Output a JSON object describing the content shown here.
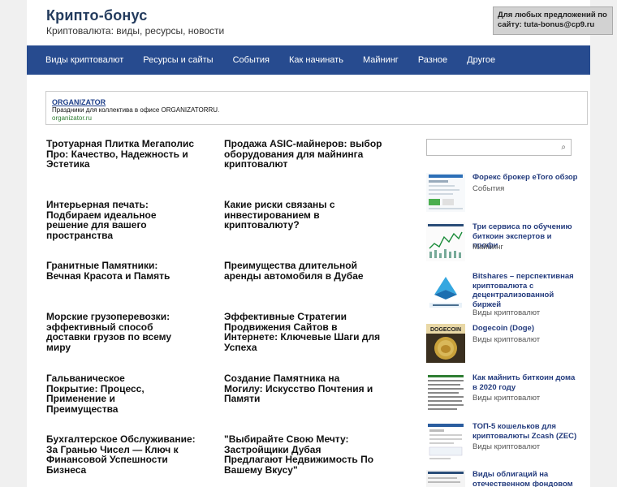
{
  "header": {
    "site_title": "Крипто-бонус",
    "site_description": "Криптовалюта: виды, ресурсы, новости",
    "ad_text": "Для любых предложений по сайту: tuta-bonus@cp9.ru"
  },
  "nav": {
    "items": [
      {
        "label": "Виды криптовалют"
      },
      {
        "label": "Ресурсы и сайты"
      },
      {
        "label": "События"
      },
      {
        "label": "Как начинать"
      },
      {
        "label": "Майнинг"
      },
      {
        "label": "Разное"
      },
      {
        "label": "Другое"
      }
    ]
  },
  "banner": {
    "brand": "ORGANIZATOR",
    "text": "Праздники для коллектива в офисе ORGANIZATORRU.",
    "url": "organizator.ru"
  },
  "posts": [
    {
      "title": "Тротуарная Плитка Мегаполис Про: Качество, Надежность и Эстетика"
    },
    {
      "title": "Продажа ASIC-майнеров: выбор оборудования для майнинга криптовалют"
    },
    {
      "title": "Интерьерная печать: Подбираем идеальное решение для вашего пространства"
    },
    {
      "title": "Какие риски связаны с инвестированием в криптовалюту?"
    },
    {
      "title": "Гранитные Памятники: Вечная Красота и Память"
    },
    {
      "title": "Преимущества длительной аренды автомобиля в Дубае"
    },
    {
      "title": "Морские грузоперевозки: эффективный способ доставки грузов по всему миру"
    },
    {
      "title": "Эффективные Стратегии Продвижения Сайтов в Интернете: Ключевые Шаги для Успеха"
    },
    {
      "title": "Гальваническое Покрытие: Процесс, Применение и Преимущества"
    },
    {
      "title": "Создание Памятника на Могилу: Искусство Почтения и Памяти"
    },
    {
      "title": "Бухгалтерское Обслуживание: За Гранью Чисел — Ключ к Финансовой Успешности Бизнеса"
    },
    {
      "title": "\"Выбирайте Свою Мечту: Застройщики Дубая Предлагают Недвижимость По Вашему Вкусу\""
    }
  ],
  "sidebar": {
    "search_placeholder": "",
    "search_icon": "search-icon",
    "items": [
      {
        "title": "Форекс брокер eToro обзор",
        "category": "События"
      },
      {
        "title": "Три сервиса по обучению биткоин экспертов и профи",
        "category": "Майнинг"
      },
      {
        "title": "Bitshares – перспективная криптовалюта с децентрализованной биржей",
        "category": "Виды криптовалют"
      },
      {
        "title": "Dogecoin (Doge)",
        "category": "Виды криптовалют",
        "thumb_label": "DOGECOIN"
      },
      {
        "title": "Как майнить биткоин дома в 2020 году",
        "category": "Виды криптовалют"
      },
      {
        "title": "ТОП-5 кошельков для криптовалюты Zcash (ZEC)",
        "category": "Виды криптовалют"
      },
      {
        "title": "Виды облигаций на отечественном фондовом",
        "category": ""
      }
    ]
  }
}
